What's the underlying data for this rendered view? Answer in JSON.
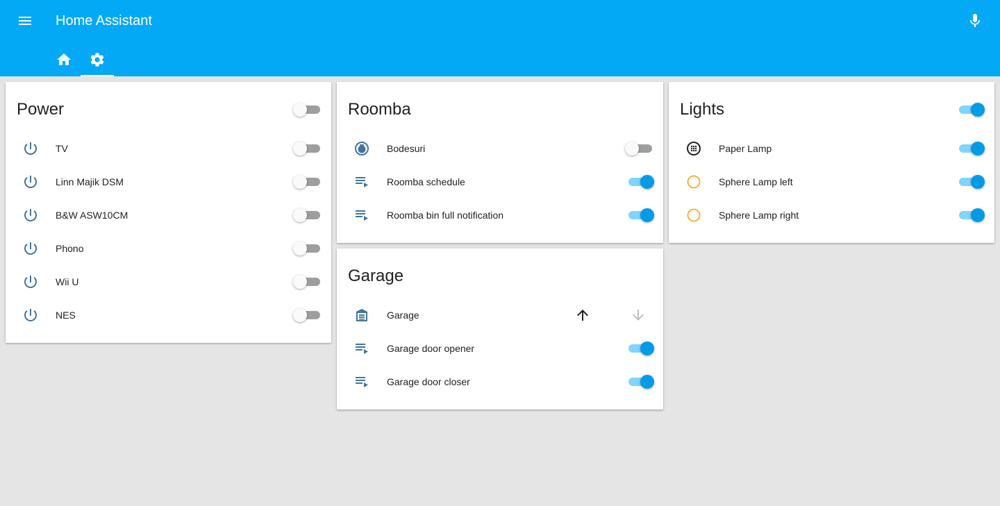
{
  "app": {
    "title": "Home Assistant",
    "accent_color": "#03a9f4",
    "menu_icon": "menu-icon",
    "mic_icon": "microphone-icon"
  },
  "tabs": [
    {
      "icon": "home-icon",
      "selected": false
    },
    {
      "icon": "gear-icon",
      "selected": true
    }
  ],
  "cards": {
    "power": {
      "title": "Power",
      "header_toggle_on": false,
      "rows": [
        {
          "label": "TV",
          "icon": "power-icon",
          "on": false
        },
        {
          "label": "Linn Majik DSM",
          "icon": "power-icon",
          "on": false
        },
        {
          "label": "B&W ASW10CM",
          "icon": "power-icon",
          "on": false
        },
        {
          "label": "Phono",
          "icon": "power-icon",
          "on": false
        },
        {
          "label": "Wii U",
          "icon": "power-icon",
          "on": false
        },
        {
          "label": "NES",
          "icon": "power-icon",
          "on": false
        }
      ]
    },
    "roomba": {
      "title": "Roomba",
      "rows": [
        {
          "label": "Bodesuri",
          "icon": "robot-vacuum-icon",
          "on": false
        },
        {
          "label": "Roomba schedule",
          "icon": "script-playlist-icon",
          "on": true
        },
        {
          "label": "Roomba bin full notification",
          "icon": "script-playlist-icon",
          "on": true
        }
      ]
    },
    "garage": {
      "title": "Garage",
      "rows": [
        {
          "label": "Garage",
          "icon": "garage-icon",
          "controls": [
            "arrow-up-icon",
            "arrow-down-icon"
          ]
        },
        {
          "label": "Garage door opener",
          "icon": "script-playlist-icon",
          "on": true
        },
        {
          "label": "Garage door closer",
          "icon": "script-playlist-icon",
          "on": true
        }
      ]
    },
    "lights": {
      "title": "Lights",
      "header_toggle_on": true,
      "rows": [
        {
          "label": "Paper Lamp",
          "icon": "light-grid-icon",
          "on": true
        },
        {
          "label": "Sphere Lamp left",
          "icon": "bulb-outline-icon",
          "on": true
        },
        {
          "label": "Sphere Lamp right",
          "icon": "bulb-outline-icon",
          "on": true
        }
      ]
    }
  },
  "colors": {
    "icon_blue": "#44739e",
    "toggle_on": "#039be5",
    "toggle_on_track": "#81d4fa",
    "light_on_icon": "#fdd835",
    "light_ring": "#f9a825"
  }
}
